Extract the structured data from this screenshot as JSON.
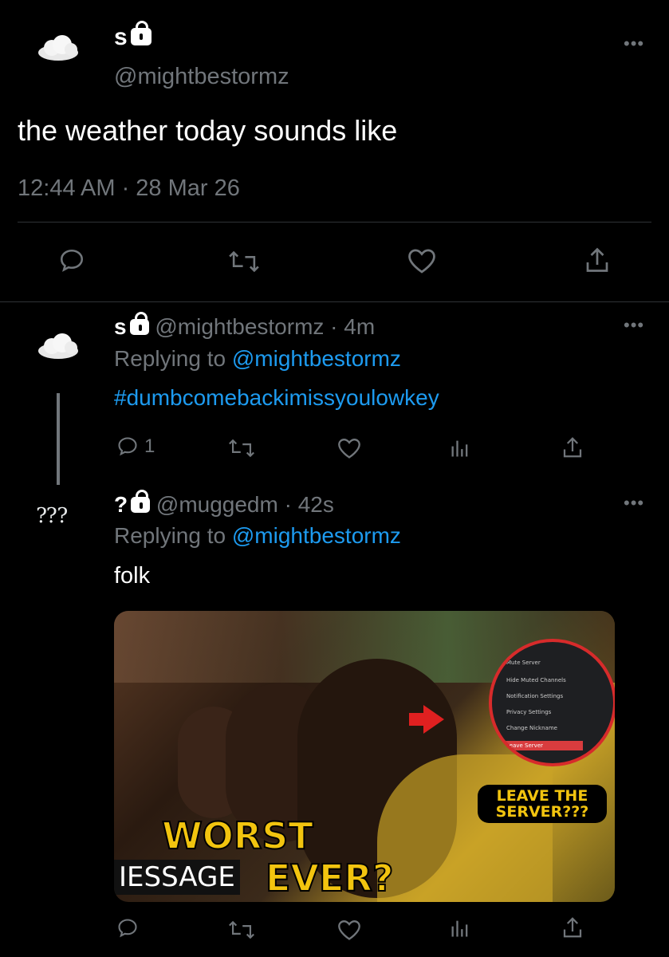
{
  "main_tweet": {
    "avatar": "cloud-emoji",
    "display_name": "s",
    "handle": "@mightbestormz",
    "text": "the weather today sounds like",
    "timestamp": "12:44 AM · 28 Mar 26"
  },
  "reply1": {
    "avatar": "cloud-emoji",
    "display_name": "s",
    "handle_time": "@mightbestormz · 4m",
    "replying_prefix": "Replying to",
    "replying_to": "@mightbestormz",
    "text": "#dumbcomebackimissyoulowkey",
    "reply_count": "1"
  },
  "reply2": {
    "avatar_text": "⁇?",
    "display_name": "?",
    "handle_time": "@muggedm · 42s",
    "replying_prefix": "Replying to",
    "replying_to": "@mightbestormz",
    "text": "folk",
    "media": {
      "caption_worst": "WORST",
      "caption_message": "IESSAGE",
      "caption_ever": "EVER?",
      "caption_leave": "LEAVE THE SERVER???",
      "menu_items": [
        "Mute Server",
        "Hide Muted Channels",
        "Notification Settings",
        "Privacy Settings",
        "Change Nickname",
        "Leave Server"
      ]
    }
  },
  "icons": {
    "more": "more-horizontal-icon",
    "reply": "comment-icon",
    "retweet": "retweet-icon",
    "like": "heart-icon",
    "share": "share-icon",
    "views": "analytics-icon",
    "lock": "lock-icon"
  },
  "colors": {
    "background": "#000000",
    "text": "#e7e9ea",
    "muted": "#71767b",
    "link": "#1d9bf0",
    "divider": "#2f3336"
  }
}
